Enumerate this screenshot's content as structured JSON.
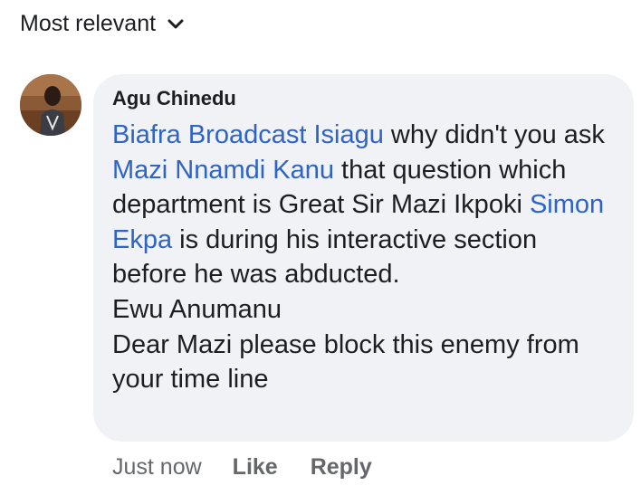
{
  "sort": {
    "label": "Most relevant",
    "icon": "chevron-down-icon"
  },
  "comment": {
    "author": "Agu Chinedu",
    "avatar_icon": "profile-photo",
    "mentions": {
      "m1": "Biafra Broadcast Isiagu",
      "m2": "Mazi Nnamdi Kanu",
      "m3": "Simon Ekpa"
    },
    "text": {
      "t1": " why  didn't you ask ",
      "t2": " that question which department is Great Sir Mazi Ikpoki ",
      "t3": "  is during his interactive section  before he was abducted.",
      "t4": "Ewu Anumanu",
      "t5": "Dear Mazi please block this enemy from your time line"
    },
    "timestamp": "Just now",
    "like_label": "Like",
    "reply_label": "Reply"
  },
  "colors": {
    "mention": "#2e63c8",
    "bubble_bg": "#f0f2f5",
    "secondary_text": "#65676b"
  }
}
